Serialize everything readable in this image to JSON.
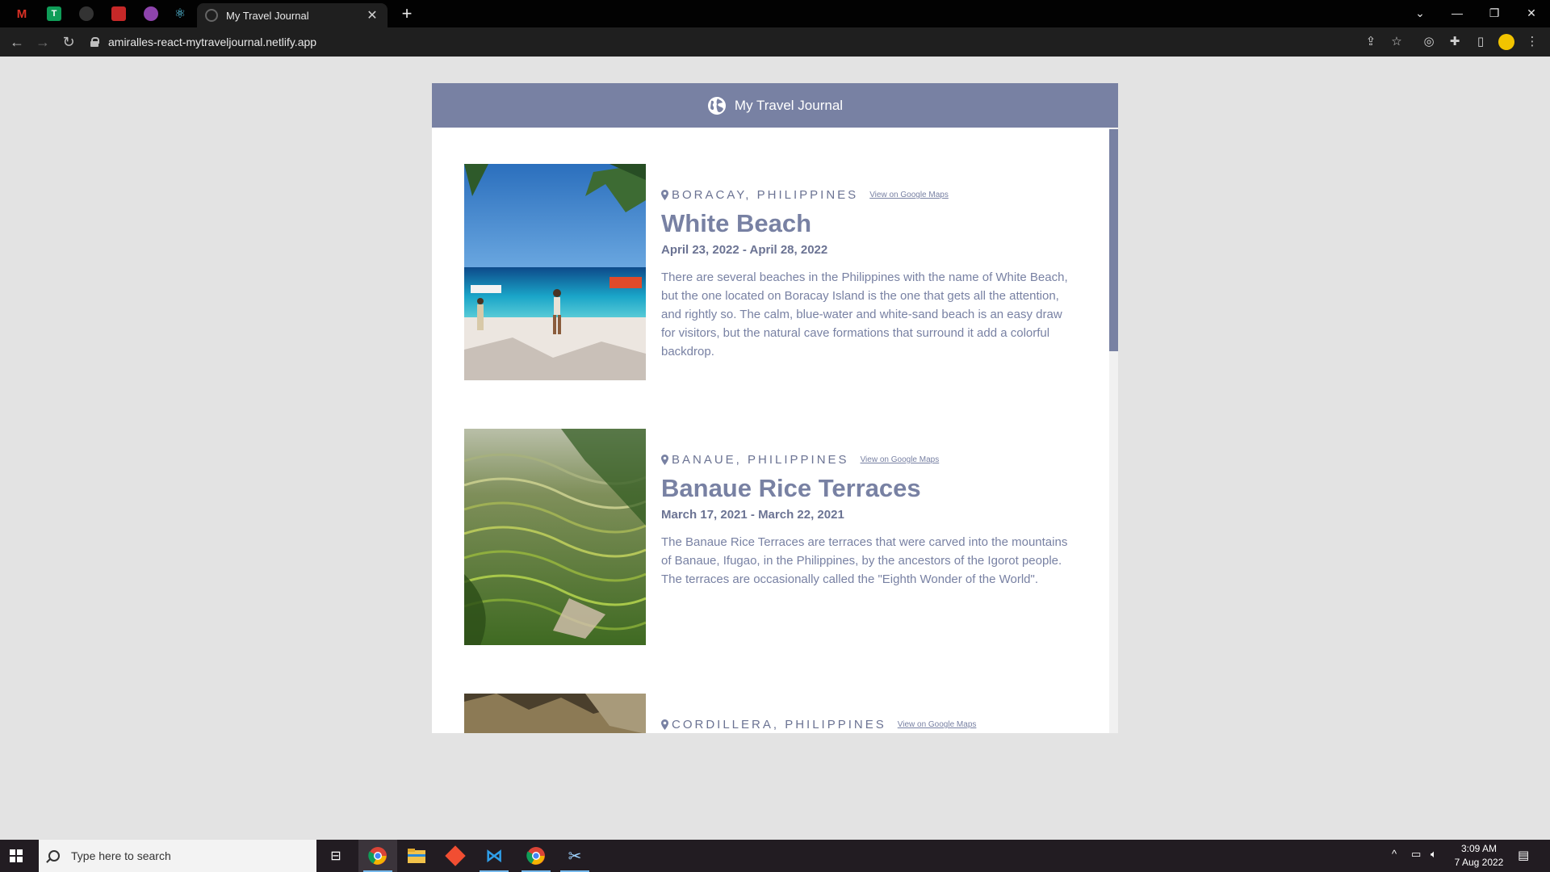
{
  "browser": {
    "pinned_tabs": [
      {
        "icon": "gmail-icon",
        "letter": "M",
        "color": "#d93025"
      },
      {
        "icon": "sheets-icon",
        "letter": "T",
        "color": "#0f9d58"
      },
      {
        "icon": "github-icon",
        "letter": "",
        "color": "#333333"
      },
      {
        "icon": "red-app-icon",
        "letter": "",
        "color": "#c62828"
      },
      {
        "icon": "purple-app-icon",
        "letter": "",
        "color": "#8e44ad"
      },
      {
        "icon": "react-icon",
        "letter": "",
        "color": "#61dafb"
      }
    ],
    "active_tab_title": "My Travel Journal",
    "url": "amiralles-react-mytraveljournal.netlify.app"
  },
  "app": {
    "title": "My Travel Journal",
    "accent_color": "#7881a3",
    "entries": [
      {
        "location": "BORACAY, PHILIPPINES",
        "maps_link": "View on Google Maps",
        "title": "White Beach",
        "dates": "April 23, 2022 - April 28, 2022",
        "description": "There are several beaches in the Philippines with the name of White Beach, but the one located on Boracay Island is the one that gets all the attention, and rightly so. The calm, blue-water and white-sand beach is an easy draw for visitors, but the natural cave formations that surround it add a colorful backdrop."
      },
      {
        "location": "BANAUE, PHILIPPINES",
        "maps_link": "View on Google Maps",
        "title": "Banaue Rice Terraces",
        "dates": "March 17, 2021 - March 22, 2021",
        "description": "The Banaue Rice Terraces are terraces that were carved into the mountains of Banaue, Ifugao, in the Philippines, by the ancestors of the Igorot people. The terraces are occasionally called the \"Eighth Wonder of the World\"."
      },
      {
        "location": "CORDILLERA, PHILIPPINES",
        "maps_link": "View on Google Maps"
      }
    ]
  },
  "taskbar": {
    "search_placeholder": "Type here to search",
    "time": "3:09 AM",
    "date": "7 Aug 2022"
  }
}
